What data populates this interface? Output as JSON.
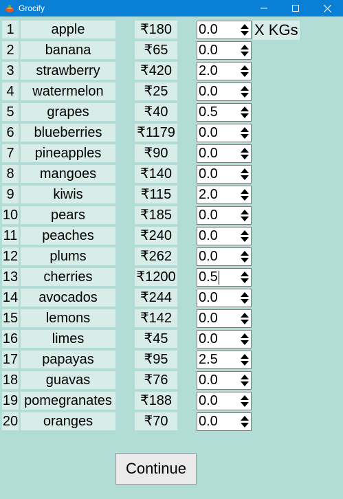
{
  "window": {
    "title": "Grocify",
    "icon": "grocify-logo-icon"
  },
  "unit_label": "X KGs",
  "items": [
    {
      "num": "1",
      "name": "apple",
      "price": "₹180",
      "qty": "0.0"
    },
    {
      "num": "2",
      "name": "banana",
      "price": "₹65",
      "qty": "0.0"
    },
    {
      "num": "3",
      "name": "strawberry",
      "price": "₹420",
      "qty": "2.0"
    },
    {
      "num": "4",
      "name": "watermelon",
      "price": "₹25",
      "qty": "0.0"
    },
    {
      "num": "5",
      "name": "grapes",
      "price": "₹40",
      "qty": "0.5"
    },
    {
      "num": "6",
      "name": "blueberries",
      "price": "₹1179",
      "qty": "0.0"
    },
    {
      "num": "7",
      "name": "pineapples",
      "price": "₹90",
      "qty": "0.0"
    },
    {
      "num": "8",
      "name": "mangoes",
      "price": "₹140",
      "qty": "0.0"
    },
    {
      "num": "9",
      "name": "kiwis",
      "price": "₹115",
      "qty": "2.0"
    },
    {
      "num": "10",
      "name": "pears",
      "price": "₹185",
      "qty": "0.0"
    },
    {
      "num": "11",
      "name": "peaches",
      "price": "₹240",
      "qty": "0.0"
    },
    {
      "num": "12",
      "name": "plums",
      "price": "₹262",
      "qty": "0.0"
    },
    {
      "num": "13",
      "name": "cherries",
      "price": "₹1200",
      "qty": "0.5"
    },
    {
      "num": "14",
      "name": "avocados",
      "price": "₹244",
      "qty": "0.0"
    },
    {
      "num": "15",
      "name": "lemons",
      "price": "₹142",
      "qty": "0.0"
    },
    {
      "num": "16",
      "name": "limes",
      "price": "₹45",
      "qty": "0.0"
    },
    {
      "num": "17",
      "name": "papayas",
      "price": "₹95",
      "qty": "2.5"
    },
    {
      "num": "18",
      "name": "guavas",
      "price": "₹76",
      "qty": "0.0"
    },
    {
      "num": "19",
      "name": "pomegranates",
      "price": "₹188",
      "qty": "0.0"
    },
    {
      "num": "20",
      "name": "oranges",
      "price": "₹70",
      "qty": "0.0"
    }
  ],
  "focused_row": 12,
  "continue_label": "Continue",
  "colors": {
    "titlebar": "#0a7fd6",
    "background": "#b2dcd6",
    "label_bg": "#d8ece8"
  }
}
